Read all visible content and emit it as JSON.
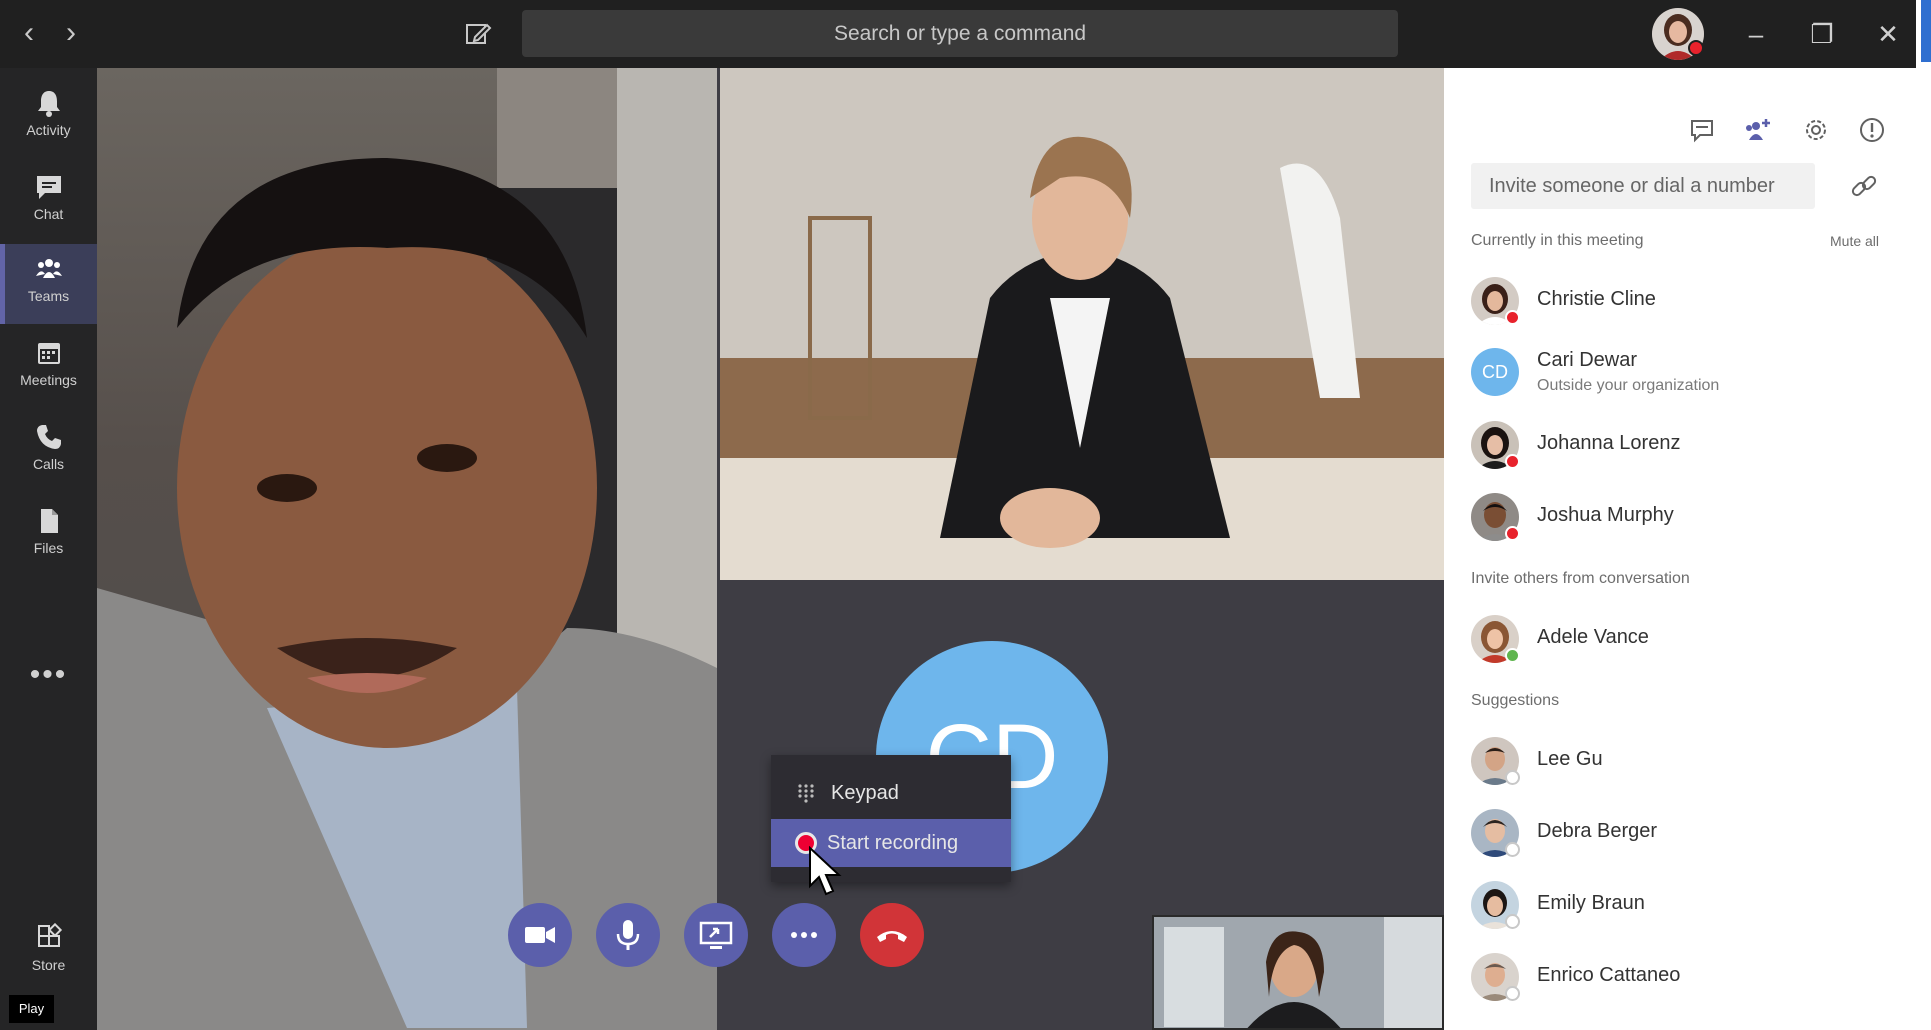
{
  "titlebar": {
    "back_glyph": "‹",
    "forward_glyph": "›",
    "search_placeholder": "Search or type a command",
    "minimize_glyph": "–",
    "maximize_glyph": "❐",
    "close_glyph": "✕"
  },
  "rail": {
    "items": [
      {
        "label": "Activity",
        "icon": "bell-icon"
      },
      {
        "label": "Chat",
        "icon": "chat-icon"
      },
      {
        "label": "Teams",
        "icon": "teams-icon",
        "active": true
      },
      {
        "label": "Meetings",
        "icon": "calendar-icon"
      },
      {
        "label": "Calls",
        "icon": "phone-icon"
      },
      {
        "label": "Files",
        "icon": "file-icon"
      }
    ],
    "more_glyph": "•••",
    "store_label": "Store",
    "play_label": "Play"
  },
  "stage": {
    "cd_initials": "CD",
    "menu": {
      "keypad_label": "Keypad",
      "record_label": "Start recording"
    },
    "controls": [
      {
        "name": "camera",
        "icon": "video-camera-icon"
      },
      {
        "name": "mic",
        "icon": "microphone-icon"
      },
      {
        "name": "share",
        "icon": "screen-share-icon"
      },
      {
        "name": "more",
        "icon": "more-dots-icon"
      },
      {
        "name": "hangup",
        "icon": "hang-up-icon"
      }
    ]
  },
  "panel": {
    "invite_placeholder": "Invite someone or dial a number",
    "section_current": "Currently in this meeting",
    "mute_all": "Mute all",
    "section_invite_others": "Invite others from conversation",
    "section_suggestions": "Suggestions",
    "current": [
      {
        "name": "Christie Cline",
        "status": "red"
      },
      {
        "name": "Cari Dewar",
        "sub": "Outside your organization",
        "initials": "CD"
      },
      {
        "name": "Johanna Lorenz",
        "status": "red"
      },
      {
        "name": "Joshua Murphy",
        "status": "red"
      }
    ],
    "conversation": [
      {
        "name": "Adele Vance",
        "status": "green"
      }
    ],
    "suggestions": [
      {
        "name": "Lee Gu"
      },
      {
        "name": "Debra Berger"
      },
      {
        "name": "Emily Braun"
      },
      {
        "name": "Enrico Cattaneo"
      }
    ],
    "colors": {
      "accent": "#5b5fab",
      "hangup": "#d13438",
      "avatar_blue": "#6eb6ec"
    }
  }
}
